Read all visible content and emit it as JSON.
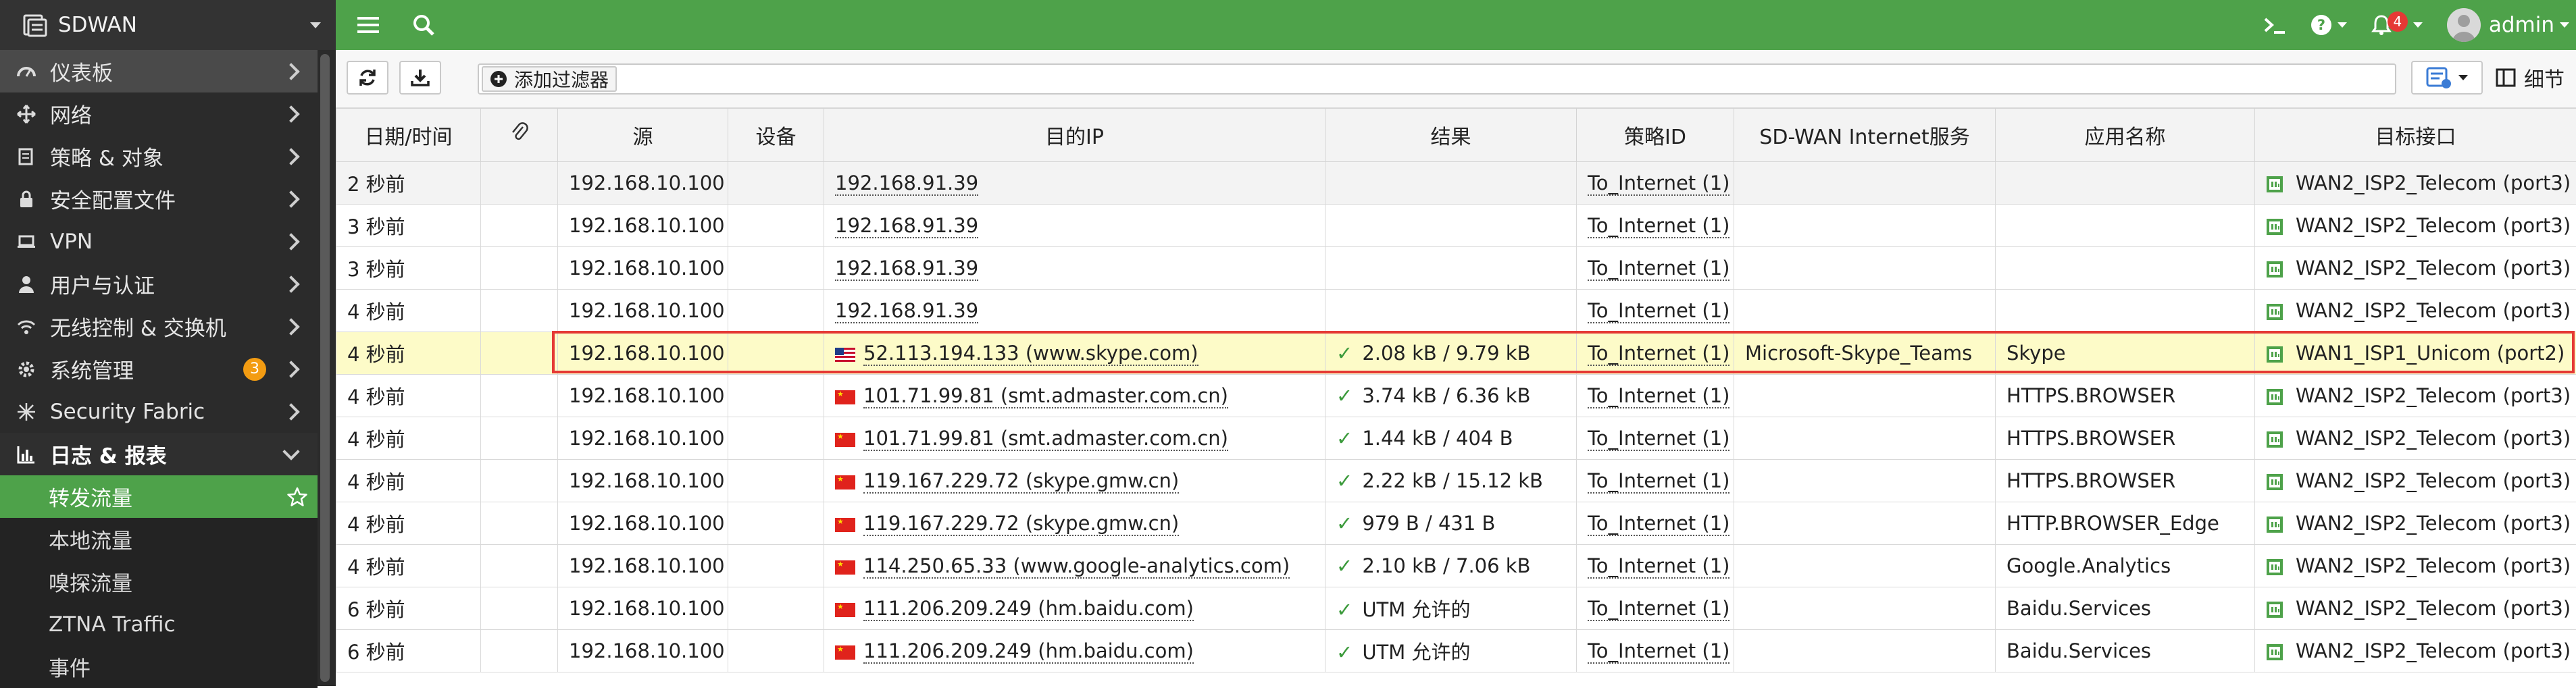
{
  "sidebar": {
    "device": "SDWAN",
    "items": [
      {
        "label": "仪表板",
        "icon": "dashboard-icon"
      },
      {
        "label": "网络",
        "icon": "network-icon"
      },
      {
        "label": "策略 & 对象",
        "icon": "policy-icon"
      },
      {
        "label": "安全配置文件",
        "icon": "lock-icon"
      },
      {
        "label": "VPN",
        "icon": "laptop-icon"
      },
      {
        "label": "用户与认证",
        "icon": "user-icon"
      },
      {
        "label": "无线控制 & 交换机",
        "icon": "wifi-icon"
      },
      {
        "label": "系统管理",
        "icon": "gear-icon",
        "badge": "3"
      },
      {
        "label": "Security Fabric",
        "icon": "fabric-icon"
      },
      {
        "label": "日志 & 报表",
        "icon": "chart-icon"
      }
    ],
    "subitems": [
      "转发流量",
      "本地流量",
      "嗅探流量",
      "ZTNA Traffic",
      "事件"
    ]
  },
  "topbar": {
    "notifications": "4",
    "user": "admin"
  },
  "toolbar": {
    "filter_label": "添加过滤器",
    "details_label": "细节"
  },
  "table": {
    "columns": [
      "日期/时间",
      "",
      "源",
      "设备",
      "目的IP",
      "结果",
      "策略ID",
      "SD-WAN Internet服务",
      "应用名称",
      "目标接口"
    ],
    "rows": [
      {
        "time": "2 秒前",
        "src": "192.168.10.100",
        "dev": "",
        "flag": "",
        "dst": "192.168.91.39",
        "result": "",
        "policy": "To_Internet (1)",
        "isdb": "",
        "app": "",
        "iface": "WAN2_ISP2_Telecom (port3)"
      },
      {
        "time": "3 秒前",
        "src": "192.168.10.100",
        "dev": "",
        "flag": "",
        "dst": "192.168.91.39",
        "result": "",
        "policy": "To_Internet (1)",
        "isdb": "",
        "app": "",
        "iface": "WAN2_ISP2_Telecom (port3)"
      },
      {
        "time": "3 秒前",
        "src": "192.168.10.100",
        "dev": "",
        "flag": "",
        "dst": "192.168.91.39",
        "result": "",
        "policy": "To_Internet (1)",
        "isdb": "",
        "app": "",
        "iface": "WAN2_ISP2_Telecom (port3)"
      },
      {
        "time": "4 秒前",
        "src": "192.168.10.100",
        "dev": "",
        "flag": "",
        "dst": "192.168.91.39",
        "result": "",
        "policy": "To_Internet (1)",
        "isdb": "",
        "app": "",
        "iface": "WAN2_ISP2_Telecom (port3)"
      },
      {
        "time": "4 秒前",
        "src": "192.168.10.100",
        "dev": "",
        "flag": "us",
        "dst": "52.113.194.133 (www.skype.com)",
        "result": "2.08 kB / 9.79 kB",
        "policy": "To_Internet (1)",
        "isdb": "Microsoft-Skype_Teams",
        "app": "Skype",
        "iface": "WAN1_ISP1_Unicom (port2)"
      },
      {
        "time": "4 秒前",
        "src": "192.168.10.100",
        "dev": "",
        "flag": "cn",
        "dst": "101.71.99.81 (smt.admaster.com.cn)",
        "result": "3.74 kB / 6.36 kB",
        "policy": "To_Internet (1)",
        "isdb": "",
        "app": "HTTPS.BROWSER",
        "iface": "WAN2_ISP2_Telecom (port3)"
      },
      {
        "time": "4 秒前",
        "src": "192.168.10.100",
        "dev": "",
        "flag": "cn",
        "dst": "101.71.99.81 (smt.admaster.com.cn)",
        "result": "1.44 kB / 404 B",
        "policy": "To_Internet (1)",
        "isdb": "",
        "app": "HTTPS.BROWSER",
        "iface": "WAN2_ISP2_Telecom (port3)"
      },
      {
        "time": "4 秒前",
        "src": "192.168.10.100",
        "dev": "",
        "flag": "cn",
        "dst": "119.167.229.72 (skype.gmw.cn)",
        "result": "2.22 kB / 15.12 kB",
        "policy": "To_Internet (1)",
        "isdb": "",
        "app": "HTTPS.BROWSER",
        "iface": "WAN2_ISP2_Telecom (port3)"
      },
      {
        "time": "4 秒前",
        "src": "192.168.10.100",
        "dev": "",
        "flag": "cn",
        "dst": "119.167.229.72 (skype.gmw.cn)",
        "result": "979 B / 431 B",
        "policy": "To_Internet (1)",
        "isdb": "",
        "app": "HTTP.BROWSER_Edge",
        "iface": "WAN2_ISP2_Telecom (port3)"
      },
      {
        "time": "4 秒前",
        "src": "192.168.10.100",
        "dev": "",
        "flag": "cn",
        "dst": "114.250.65.33 (www.google-analytics.com)",
        "result": "2.10 kB / 7.06 kB",
        "policy": "To_Internet (1)",
        "isdb": "",
        "app": "Google.Analytics",
        "iface": "WAN2_ISP2_Telecom (port3)"
      },
      {
        "time": "6 秒前",
        "src": "192.168.10.100",
        "dev": "",
        "flag": "cn",
        "dst": "111.206.209.249 (hm.baidu.com)",
        "result": "UTM 允许的",
        "policy": "To_Internet (1)",
        "isdb": "",
        "app": "Baidu.Services",
        "iface": "WAN2_ISP2_Telecom (port3)"
      },
      {
        "time": "6 秒前",
        "src": "192.168.10.100",
        "dev": "",
        "flag": "cn",
        "dst": "111.206.209.249 (hm.baidu.com)",
        "result": "UTM 允许的",
        "policy": "To_Internet (1)",
        "isdb": "",
        "app": "Baidu.Services",
        "iface": "WAN2_ISP2_Telecom (port3)"
      }
    ],
    "highlight_row": 4
  },
  "colors": {
    "topbar": "#4ea24a",
    "sidebar": "#2b2b2b",
    "highlight_fill": "#fdfbc8",
    "highlight_border": "#e53935",
    "badge_orange": "#f39c12",
    "check_green": "#3b9a3b"
  }
}
